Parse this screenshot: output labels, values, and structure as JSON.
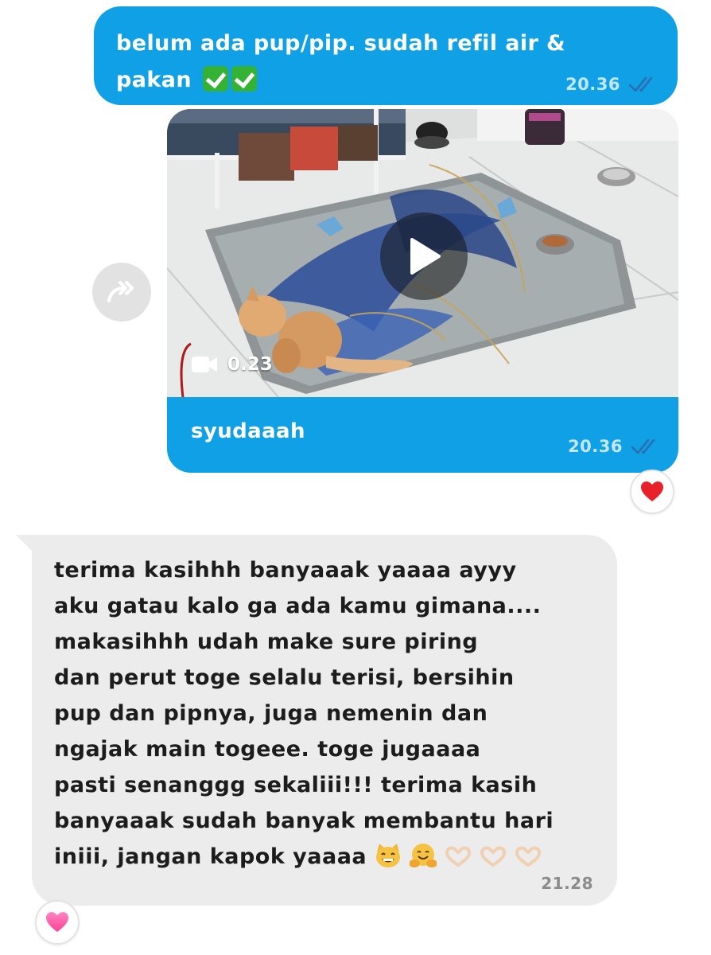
{
  "messages": {
    "out_text": {
      "text": "belum ada pup/pip. sudah refil air & pakan",
      "time": "20.36",
      "emoji": [
        "check-mark-button",
        "check-mark-button"
      ]
    },
    "out_video": {
      "duration": "0.23",
      "caption": "syudaaah",
      "time": "20.36",
      "reaction": "red-heart"
    },
    "in_text": {
      "lines": [
        "terima kasihhh banyaaak yaaaa ayyy",
        "aku gatau kalo ga ada kamu gimana....",
        "makasihhh udah make sure piring",
        "dan perut toge selalu terisi, bersihin",
        "pup dan pipnya, juga nemenin dan",
        "ngajak main togeee. toge jugaaaa",
        "pasti senanggg sekaliii!!! terima kasih",
        "banyaaak sudah banyak membantu hari",
        "iniii, jangan kapok yaaaa"
      ],
      "emoji": [
        "grinning-cat",
        "hugging-face",
        "heart-hands",
        "heart-hands",
        "heart-hands"
      ],
      "time": "21.28",
      "reaction": "pink-heart"
    }
  },
  "colors": {
    "outgoing_bubble": "#10a0e6",
    "incoming_bubble": "#ececec",
    "read_ticks": "#2a6fb0",
    "red_heart": "#e8202a",
    "pink_heart": "#ff4fa0"
  },
  "icons": [
    "forward-icon",
    "play-icon",
    "video-camera-icon",
    "double-check-icon"
  ]
}
